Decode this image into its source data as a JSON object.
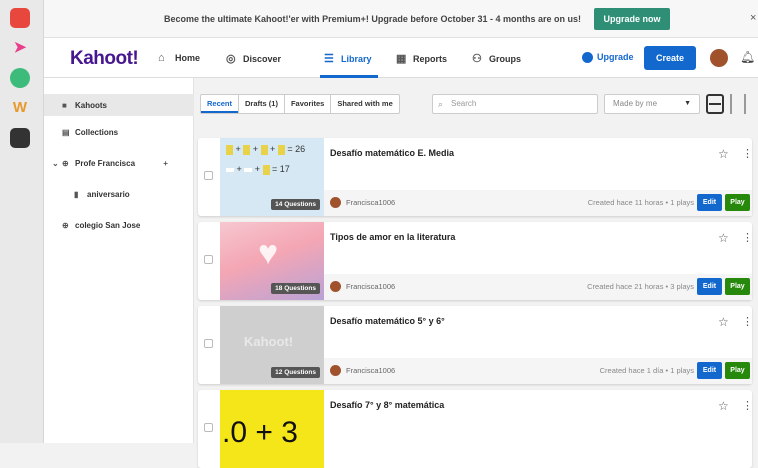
{
  "banner": {
    "text": "Become the ultimate Kahoot!'er with Premium+! Upgrade before October 31 - 4 months are on us!",
    "button": "Upgrade now",
    "close": "×"
  },
  "topbar": {
    "logo": "Kahoot!",
    "nav": [
      "Home",
      "Discover",
      "Library",
      "Reports",
      "Groups"
    ],
    "upgrade": "Upgrade",
    "create": "Create"
  },
  "sidebar": {
    "items": [
      "Kahoots",
      "Collections",
      "Profe Francisca",
      "aniversario",
      "colegio San Jose"
    ]
  },
  "toolbar": {
    "tabs": [
      "Recent",
      "Drafts (1)",
      "Favorites",
      "Shared with me"
    ],
    "search_placeholder": "Search",
    "made_by": "Made by me"
  },
  "cards": [
    {
      "title": "Desafío matemático E. Media",
      "questions": "14 Questions",
      "owner": "Francisca1006",
      "meta": "Created hace 11 horas • 1 plays",
      "edit": "Edit",
      "play": "Play"
    },
    {
      "title": "Tipos de amor en la literatura",
      "questions": "18 Questions",
      "owner": "Francisca1006",
      "meta": "Created hace 21 horas • 3 plays",
      "edit": "Edit",
      "play": "Play"
    },
    {
      "title": "Desafío matemático 5° y 6°",
      "questions": "12 Questions",
      "owner": "Francisca1006",
      "meta": "Created hace 1 día • 1 plays",
      "edit": "Edit",
      "play": "Play"
    },
    {
      "title": "Desafío 7° y 8° matemática",
      "thumb_text": ".0 + 3"
    }
  ],
  "thumb1": {
    "line1": "= 26",
    "line2": "= 17"
  },
  "thumb3": {
    "logo": "Kahoot!"
  },
  "colors": {
    "brand": "#46178f",
    "accent": "#1368ce",
    "play": "#26890c",
    "upgrade_btn": "#2f8f76"
  }
}
